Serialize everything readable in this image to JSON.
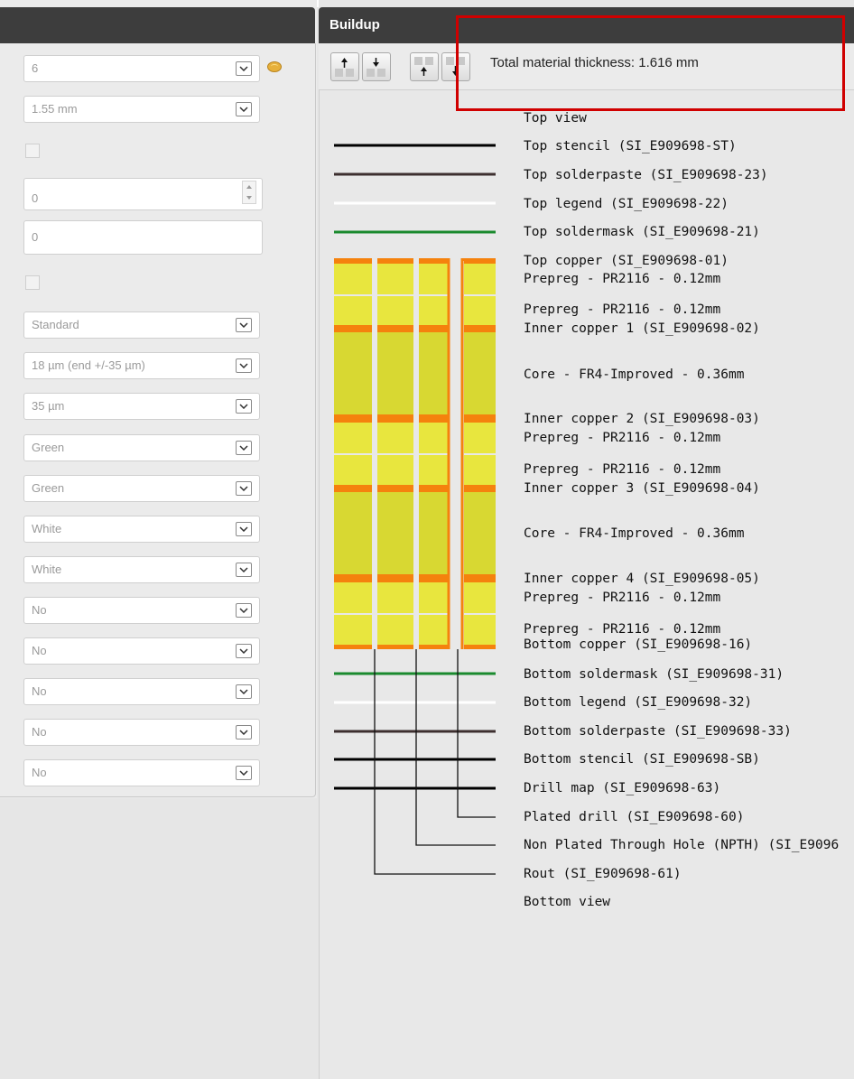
{
  "settings": {
    "layers": "6",
    "thickness": "1.55 mm",
    "spin_value": "0",
    "text_value": "0",
    "finish": "Standard",
    "inner_copper": "18 µm (end +/-35 µm)",
    "outer_copper": "35 µm",
    "top_mask_color": "Green",
    "bottom_mask_color": "Green",
    "top_legend_color": "White",
    "bottom_legend_color": "White",
    "option_1": "No",
    "option_2": "No",
    "option_3": "No",
    "option_4": "No",
    "option_5": "No"
  },
  "buildup": {
    "title": "Buildup",
    "total_thickness": "Total material thickness: 1.616 mm",
    "toolbar_icons": [
      "move-layer-top-icon",
      "move-layer-up-icon",
      "move-layer-down-icon",
      "move-layer-bottom-icon"
    ],
    "labels": {
      "top_view": "Top view",
      "top_stencil": "Top stencil (SI_E909698-ST)",
      "top_solderpaste": "Top solderpaste (SI_E909698-23)",
      "top_legend": "Top legend (SI_E909698-22)",
      "top_soldermask": "Top soldermask (SI_E909698-21)",
      "top_copper": "Top copper (SI_E909698-01)",
      "prepreg_1": "Prepreg - PR2116 - 0.12mm",
      "prepreg_2": "Prepreg - PR2116 - 0.12mm",
      "inner_copper_1": "Inner copper 1 (SI_E909698-02)",
      "core_1": "Core - FR4-Improved - 0.36mm",
      "inner_copper_2": "Inner copper 2 (SI_E909698-03)",
      "prepreg_3": "Prepreg - PR2116 - 0.12mm",
      "prepreg_4": "Prepreg - PR2116 - 0.12mm",
      "inner_copper_3": "Inner copper 3 (SI_E909698-04)",
      "core_2": "Core - FR4-Improved - 0.36mm",
      "inner_copper_4": "Inner copper 4 (SI_E909698-05)",
      "prepreg_5": "Prepreg - PR2116 - 0.12mm",
      "prepreg_6": "Prepreg - PR2116 - 0.12mm",
      "bottom_copper": "Bottom copper (SI_E909698-16)",
      "bottom_soldermask": "Bottom soldermask (SI_E909698-31)",
      "bottom_legend": "Bottom legend (SI_E909698-32)",
      "bottom_solderpaste": "Bottom solderpaste (SI_E909698-33)",
      "bottom_stencil": "Bottom stencil (SI_E909698-SB)",
      "drill_map": "Drill map (SI_E909698-63)",
      "plated_drill": "Plated drill (SI_E909698-60)",
      "npth": "Non Plated Through Hole (NPTH) (SI_E9096",
      "rout": "Rout (SI_E909698-61)",
      "bottom_view": "Bottom view"
    },
    "colors": {
      "copper": "#f5820d",
      "prepreg": "#e8e63e",
      "core": "#d8d832",
      "soldermask": "#1a8a2e",
      "legend": "#ffffff",
      "solderpaste": "#3d2f2f",
      "stencil": "#000000"
    }
  }
}
